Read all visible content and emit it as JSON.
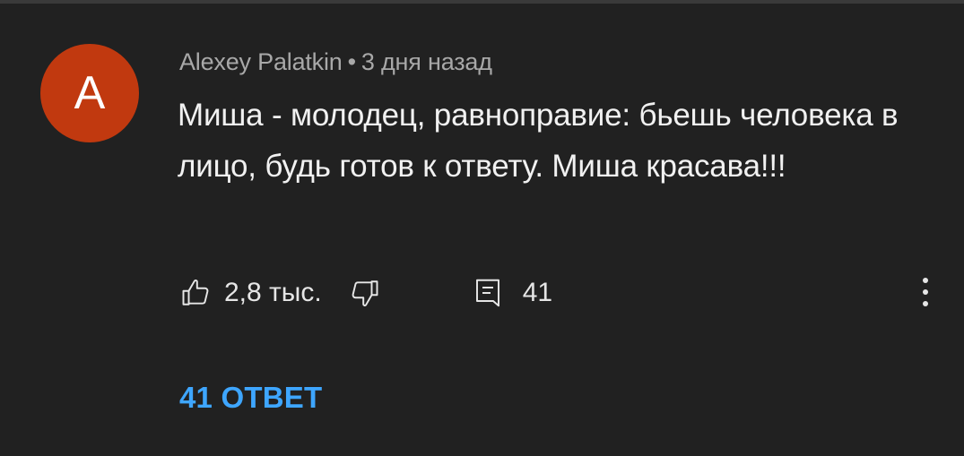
{
  "comment": {
    "avatar_letter": "A",
    "avatar_color": "#c1390f",
    "author": "Alexey Palatkin",
    "separator": "•",
    "time": "3 дня назад",
    "text": "Миша - молодец, равноправие: бьешь человека в лицо, будь готов к ответу. Миша красава!!!",
    "likes": "2,8 тыс.",
    "reply_count": "41",
    "replies_link": "41 ОТВЕТ"
  },
  "icons": {
    "like": "thumbs-up-icon",
    "dislike": "thumbs-down-icon",
    "reply": "comment-icon",
    "more": "more-vertical-icon"
  },
  "colors": {
    "background": "#212121",
    "text": "#f1f1f1",
    "meta": "#a8a8a8",
    "link": "#3ea6ff"
  }
}
